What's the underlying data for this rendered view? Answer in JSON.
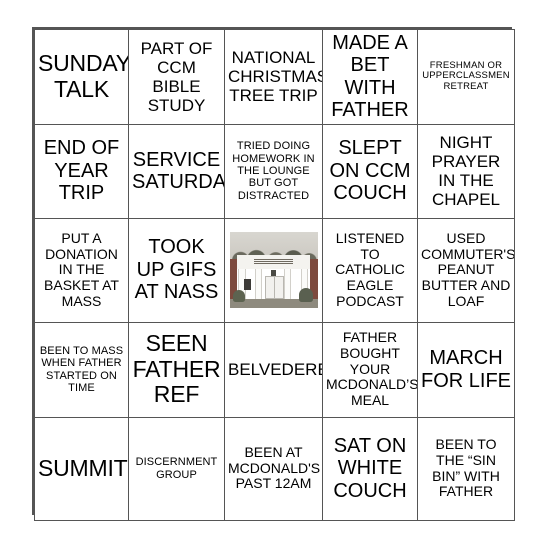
{
  "card": {
    "type": "bingo-card",
    "rows": 5,
    "columns": 5,
    "border_color": "#555555",
    "background_color": "#ffffff",
    "text_color": "#000000",
    "cells": [
      [
        {
          "text": "SUNDAY TALK",
          "size": "xl"
        },
        {
          "text": "PART OF CCM BIBLE STUDY",
          "size": "md"
        },
        {
          "text": "NATIONAL CHRISTMAS TREE TRIP",
          "size": "md"
        },
        {
          "text": "MADE A BET WITH FATHER",
          "size": "lg"
        },
        {
          "text": "FRESHMAN OR UPPERCLASSMEN RETREAT",
          "size": "xxs"
        }
      ],
      [
        {
          "text": "END OF YEAR TRIP",
          "size": "lg"
        },
        {
          "text": "SERVICE SATURDAY",
          "size": "lg"
        },
        {
          "text": "TRIED DOING HOMEWORK IN THE LOUNGE BUT GOT DISTRACTED",
          "size": "xs"
        },
        {
          "text": "SLEPT ON CCM COUCH",
          "size": "lg"
        },
        {
          "text": "NIGHT PRAYER IN THE CHAPEL",
          "size": "md"
        }
      ],
      [
        {
          "text": "PUT A DONATION IN THE BASKET AT MASS",
          "size": "sm"
        },
        {
          "text": "TOOK UP GIFS AT NASS",
          "size": "lg"
        },
        {
          "text": "",
          "size": "md",
          "image": "church-building-photo"
        },
        {
          "text": "LISTENED TO CATHOLIC EAGLE PODCAST",
          "size": "sm"
        },
        {
          "text": "USED COMMUTER'S PEANUT BUTTER AND LOAF",
          "size": "sm"
        }
      ],
      [
        {
          "text": "BEEN TO MASS WHEN FATHER STARTED ON TIME",
          "size": "xs"
        },
        {
          "text": "SEEN FATHER REF",
          "size": "xl"
        },
        {
          "text": "BELVEDERE",
          "size": "md"
        },
        {
          "text": "FATHER BOUGHT YOUR MCDONALD’S MEAL",
          "size": "sm"
        },
        {
          "text": "MARCH FOR LIFE",
          "size": "lg"
        }
      ],
      [
        {
          "text": "SUMMIT",
          "size": "xl"
        },
        {
          "text": "DISCERNMENT GROUP",
          "size": "xs"
        },
        {
          "text": "BEEN AT MCDONALD'S PAST 12AM",
          "size": "sm"
        },
        {
          "text": "SAT ON WHITE COUCH",
          "size": "lg"
        },
        {
          "text": "BEEN TO THE “SIN BIN” WITH FATHER",
          "size": "sm"
        }
      ]
    ]
  }
}
